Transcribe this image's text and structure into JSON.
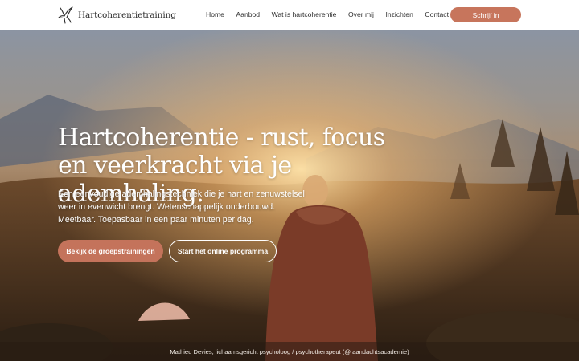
{
  "header": {
    "logo_text": "Hartcoherentietraining",
    "logo_icon": "bird-icon",
    "nav": [
      {
        "label": "Home",
        "active": true
      },
      {
        "label": "Aanbod"
      },
      {
        "label": "Wat is hartcoherentie"
      },
      {
        "label": "Over mij"
      },
      {
        "label": "Inzichten"
      },
      {
        "label": "Contact"
      }
    ],
    "cta_label": "Schrijf in"
  },
  "hero": {
    "title": "Hartcoherentie - rust, focus en veerkracht via je ademhaling.",
    "subtitle_lines": [
      "Een eenvoudige ademhalingstechniek die je hart en zenuwstelsel",
      "weer in evenwicht brengt. Wetenschappelijk onderbouwd.",
      "Meetbaar. Toepasbaar in een paar minuten per dag."
    ],
    "primary_button": "Bekijk de groepstrainingen",
    "secondary_button": "Start het online programma",
    "caption_prefix": "Mathieu Devies, lichaamsgericht psycholoog / psychotherapeut (",
    "caption_link": "@ aandachtsacademie",
    "caption_suffix": ")"
  },
  "colors": {
    "accent": "#c7755c",
    "text_dark": "#2e2e2e",
    "hero_text": "#ffffff"
  }
}
